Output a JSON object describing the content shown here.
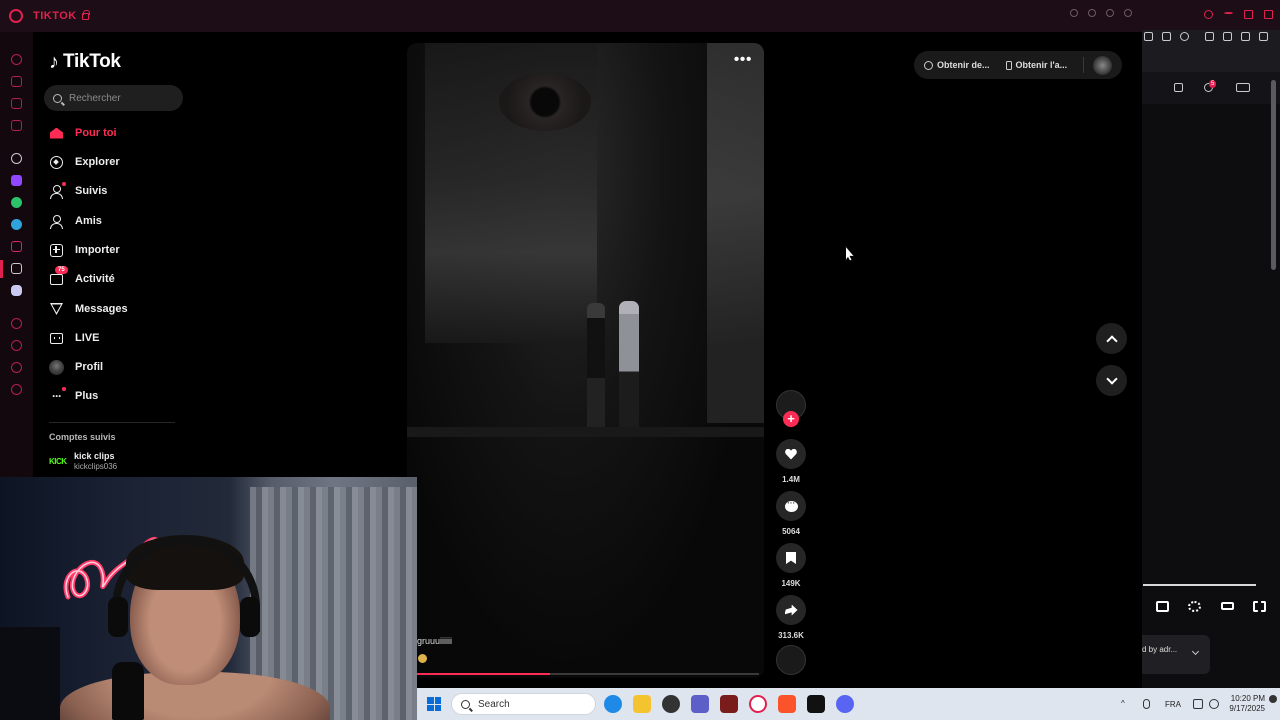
{
  "window": {
    "tab_title": "TIKTOK"
  },
  "tiktok": {
    "brand": "TikTok",
    "search_placeholder": "Rechercher",
    "nav": [
      {
        "label": "Pour toi"
      },
      {
        "label": "Explorer"
      },
      {
        "label": "Suivis"
      },
      {
        "label": "Amis"
      },
      {
        "label": "Importer"
      },
      {
        "label": "Activité",
        "badge": "75"
      },
      {
        "label": "Messages"
      },
      {
        "label": "LIVE"
      },
      {
        "label": "Profil"
      },
      {
        "label": "Plus"
      }
    ],
    "followed_title": "Comptes suivis",
    "followed": [
      {
        "logo": "KICK",
        "name": "kick clips",
        "handle": "kickclips036"
      }
    ],
    "top_actions": {
      "coins": "Obtenir de...",
      "app": "Obtenir l'a..."
    },
    "video": {
      "caption": "gruuuiiiiii",
      "progress_fraction": 0.39,
      "likes": "1.4M",
      "comments": "5064",
      "saves": "149K",
      "shares": "313.6K"
    }
  },
  "right_panel": {
    "notification_badge": "5",
    "tooltip_text": "d by adr..."
  },
  "taskbar": {
    "search_label": "Search",
    "language": "FRA",
    "time": "10:20 PM",
    "date": "9/17/2025"
  },
  "colors": {
    "tiktok_accent": "#fe2c55",
    "opera_red": "#e0214f",
    "kick_green": "#53fc18"
  }
}
